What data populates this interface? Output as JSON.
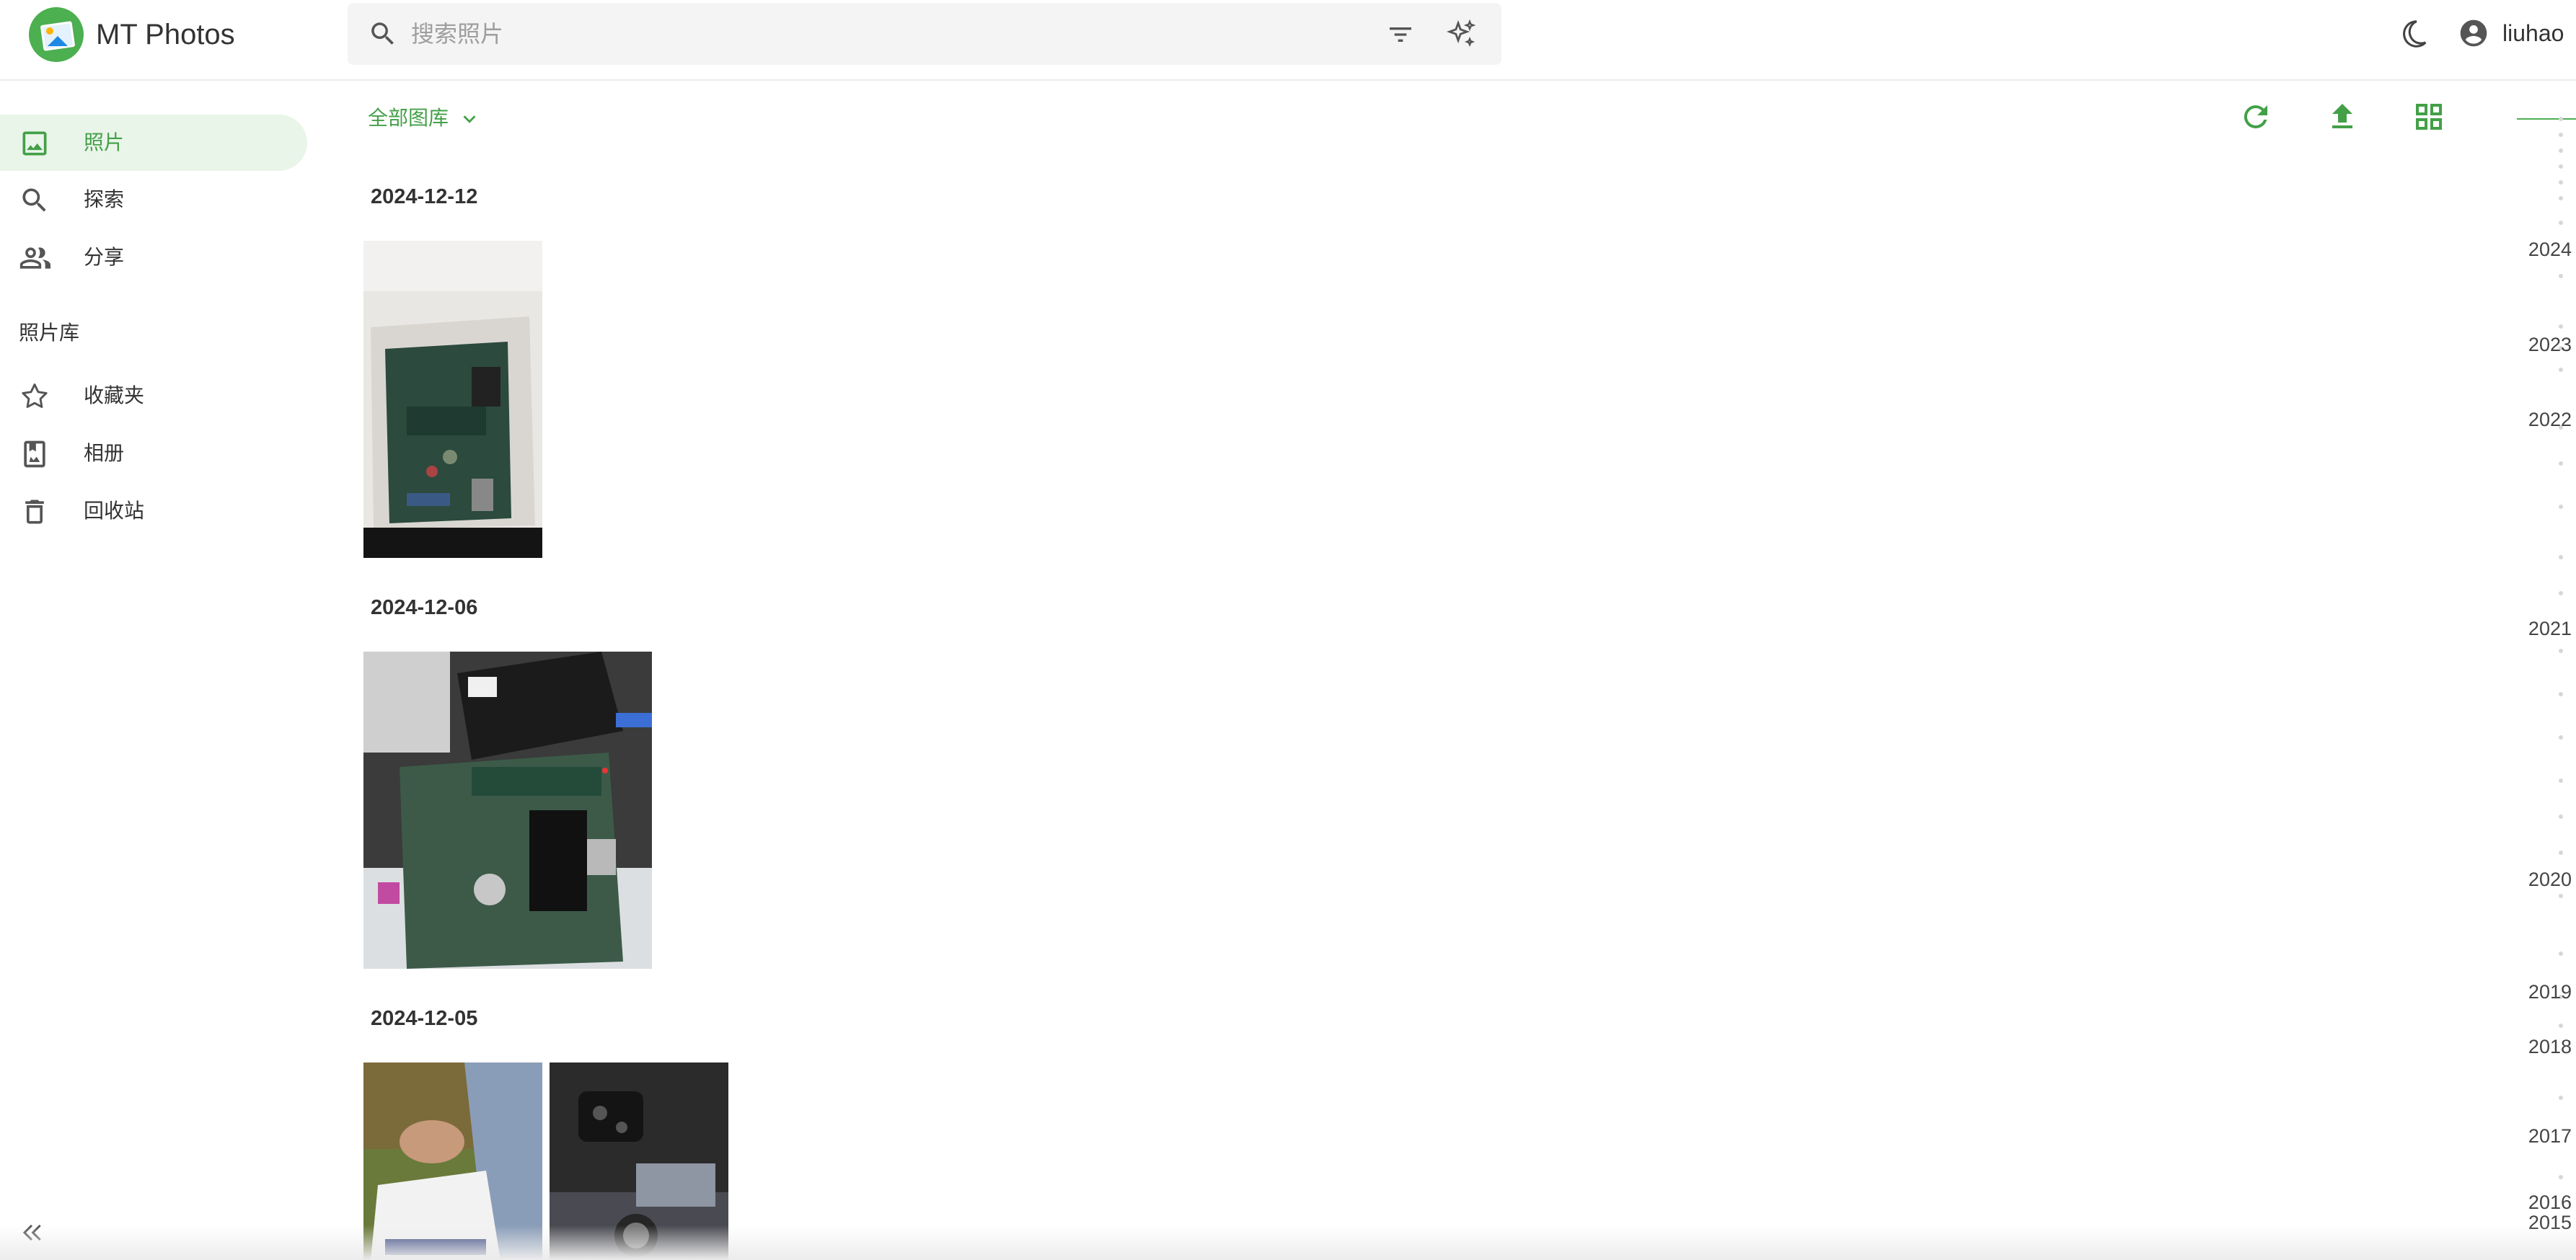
{
  "header": {
    "app_name": "MT Photos",
    "search_placeholder": "搜索照片",
    "username": "liuhao"
  },
  "sidebar": {
    "items": [
      {
        "label": "照片",
        "icon": "image-icon",
        "active": true
      },
      {
        "label": "探索",
        "icon": "search-icon",
        "active": false
      },
      {
        "label": "分享",
        "icon": "people-icon",
        "active": false
      }
    ],
    "section_title": "照片库",
    "library_items": [
      {
        "label": "收藏夹",
        "icon": "star-icon"
      },
      {
        "label": "相册",
        "icon": "album-icon"
      },
      {
        "label": "回收站",
        "icon": "trash-icon"
      }
    ]
  },
  "toolbar": {
    "library_filter": "全部图库",
    "actions": [
      "refresh-icon",
      "upload-icon",
      "grid-view-icon"
    ]
  },
  "groups": [
    {
      "date": "2024-12-12",
      "photos": 1
    },
    {
      "date": "2024-12-06",
      "photos": 1
    },
    {
      "date": "2024-12-05",
      "photos": 2
    }
  ],
  "timeline": {
    "years": [
      "2024",
      "2023",
      "2022",
      "2021",
      "2020",
      "2019",
      "2018",
      "2017",
      "2016",
      "2015"
    ]
  },
  "colors": {
    "accent": "#43a047",
    "active_bg": "#eaf5ea",
    "search_bg": "#f4f4f4"
  }
}
